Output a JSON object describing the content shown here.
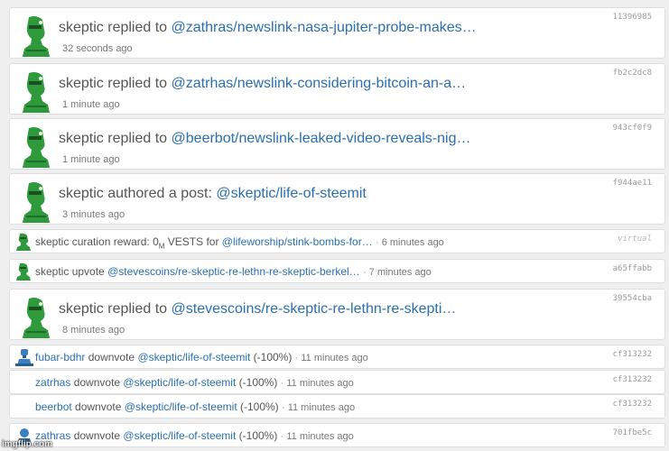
{
  "feed": [
    {
      "type": "big",
      "user": "skeptic",
      "action": "replied to",
      "target": "@zathras/newslink-nasa-jupiter-probe-makes…",
      "time": "32 seconds ago",
      "hash": "11396985"
    },
    {
      "type": "big",
      "user": "skeptic",
      "action": "replied to",
      "target": "@zatrhas/newslink-considering-bitcoin-an-a…",
      "time": "1 minute ago",
      "hash": "fb2c2dc8"
    },
    {
      "type": "big",
      "user": "skeptic",
      "action": "replied to",
      "target": "@beerbot/newslink-leaked-video-reveals-nig…",
      "time": "1 minute ago",
      "hash": "943cf0f9"
    },
    {
      "type": "big",
      "user": "skeptic",
      "action": "authored a post:",
      "target": "@skeptic/life-of-steemit",
      "time": "3 minutes ago",
      "hash": "f944ae11"
    },
    {
      "type": "small",
      "user": "skeptic",
      "action_pre": "curation reward: 0",
      "action_sub": "M",
      "action_post": "VESTS for",
      "target": "@lifeworship/stink-bombs-for…",
      "suffix": "",
      "time": "6 minutes ago",
      "hash": "virtual"
    },
    {
      "type": "small",
      "user": "skeptic",
      "action_pre": "upvote",
      "action_sub": "",
      "action_post": "",
      "target": "@stevescoins/re-skeptic-re-lethn-re-skeptic-berkel…",
      "suffix": "",
      "time": "7 minutes ago",
      "hash": "a65ffabb"
    },
    {
      "type": "big",
      "user": "skeptic",
      "action": "replied to",
      "target": "@stevescoins/re-skeptic-re-lethn-re-skepti…",
      "time": "8 minutes ago",
      "hash": "39554cba"
    },
    {
      "type": "small",
      "user": "fubar-bdhr",
      "action_pre": "downvote",
      "action_sub": "",
      "action_post": "",
      "target": "@skeptic/life-of-steemit",
      "suffix": "(-100%)",
      "time": "11 minutes ago",
      "hash": "cf313232"
    },
    {
      "type": "small",
      "user": "zatrhas",
      "action_pre": "downvote",
      "action_sub": "",
      "action_post": "",
      "target": "@skeptic/life-of-steemit",
      "suffix": "(-100%)",
      "time": "11 minutes ago",
      "hash": "cf313232"
    },
    {
      "type": "small",
      "user": "beerbot",
      "action_pre": "downvote",
      "action_sub": "",
      "action_post": "",
      "target": "@skeptic/life-of-steemit",
      "suffix": "(-100%)",
      "time": "11 minutes ago",
      "hash": "cf313232"
    },
    {
      "type": "small",
      "user": "zathras",
      "action_pre": "downvote",
      "action_sub": "",
      "action_post": "",
      "target": "@skeptic/life-of-steemit",
      "suffix": "(-100%)",
      "time": "11 minutes ago",
      "hash": "701fbe5c"
    }
  ],
  "dot": "·",
  "watermark": "imgflip.com"
}
